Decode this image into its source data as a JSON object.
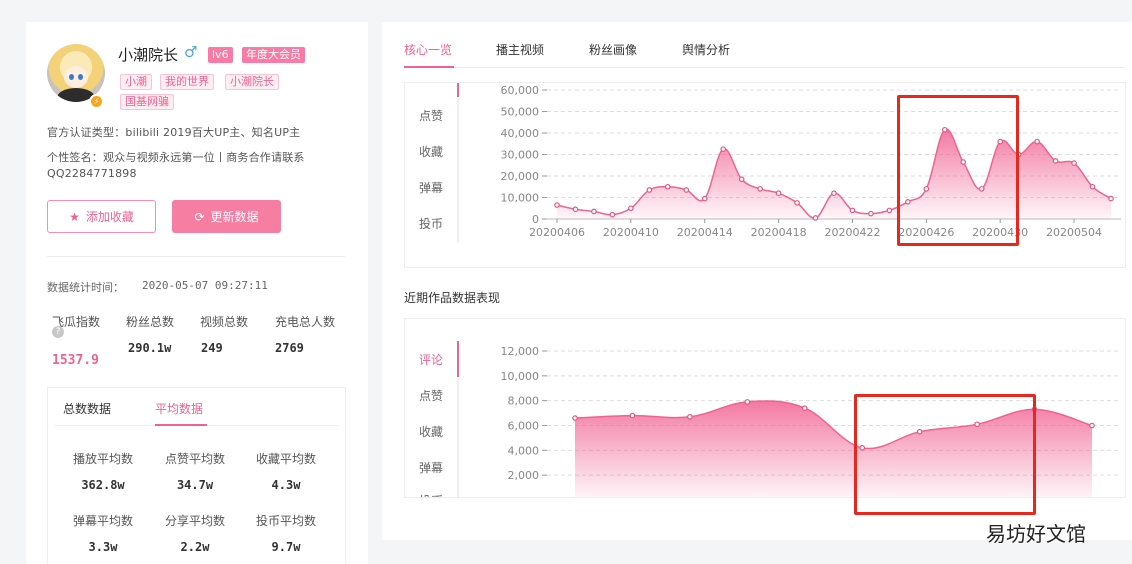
{
  "profile": {
    "name": "小潮院长",
    "gender_icon": "♂",
    "level": "lv6",
    "vip": "年度大会员",
    "tags": [
      "小潮",
      "我的世界",
      "小潮院长",
      "国基网骗"
    ],
    "cert": "官方认证类型：bilibili 2019百大UP主、知名UP主",
    "sign_line1": "个性签名：观众与视频永远第一位丨商务合作请联系",
    "sign_line2": "QQ2284771898"
  },
  "buttons": {
    "favorite": "添加收藏",
    "refresh": "更新数据"
  },
  "stats": {
    "time_label": "数据统计时间：",
    "time": "2020-05-07 09:27:11",
    "items": [
      {
        "label": "飞瓜指数",
        "value": "1537.9"
      },
      {
        "label": "粉丝总数",
        "value": "290.1w"
      },
      {
        "label": "视频总数",
        "value": "249"
      },
      {
        "label": "充电总人数",
        "value": "2769"
      }
    ]
  },
  "subtabs": [
    "总数数据",
    "平均数据"
  ],
  "averages": [
    {
      "label": "播放平均数",
      "value": "362.8w"
    },
    {
      "label": "点赞平均数",
      "value": "34.7w"
    },
    {
      "label": "收藏平均数",
      "value": "4.3w"
    },
    {
      "label": "弹幕平均数",
      "value": "3.3w"
    },
    {
      "label": "分享平均数",
      "value": "2.2w"
    },
    {
      "label": "投币平均数",
      "value": "9.7w"
    }
  ],
  "tabs": [
    "核心一览",
    "播主视频",
    "粉丝画像",
    "舆情分析"
  ],
  "section_title": "近期作品数据表现",
  "chart1_side": [
    "点赞",
    "收藏",
    "弹幕",
    "投币"
  ],
  "chart2_side": [
    "评论",
    "点赞",
    "收藏",
    "弹幕",
    "投币"
  ],
  "watermark": "易坊好文馆",
  "colors": {
    "accent": "#f06292",
    "highlight": "#e8271e"
  },
  "chart_data": [
    {
      "type": "area",
      "y_ticks": [
        "0",
        "10,000",
        "20,000",
        "30,000",
        "40,000",
        "50,000",
        "60,000"
      ],
      "ylim": [
        0,
        60000
      ],
      "x_ticks": [
        "20200406",
        "20200410",
        "20200414",
        "20200418",
        "20200422",
        "20200426",
        "20200430",
        "20200504"
      ],
      "x": [
        "20200406",
        "20200407",
        "20200408",
        "20200409",
        "20200410",
        "20200411",
        "20200412",
        "20200413",
        "20200414",
        "20200415",
        "20200416",
        "20200417",
        "20200418",
        "20200419",
        "20200420",
        "20200421",
        "20200422",
        "20200423",
        "20200424",
        "20200425",
        "20200426",
        "20200427",
        "20200428",
        "20200429",
        "20200430",
        "20200501",
        "20200502",
        "20200503",
        "20200504",
        "20200505",
        "20200506"
      ],
      "values": [
        6500,
        4500,
        3500,
        2000,
        5000,
        13500,
        15000,
        13500,
        9500,
        32500,
        18500,
        14000,
        12000,
        7500,
        500,
        12000,
        4000,
        2500,
        4000,
        8000,
        14000,
        41500,
        26500,
        14000,
        36000,
        30000,
        36000,
        27000,
        26000,
        15000,
        9500
      ]
    },
    {
      "type": "area",
      "y_ticks": [
        "2,000",
        "4,000",
        "6,000",
        "8,000",
        "10,000",
        "12,000"
      ],
      "ylim": [
        0,
        12000
      ],
      "values": [
        6600,
        6800,
        6700,
        7900,
        7400,
        4200,
        5500,
        6100,
        7300,
        6000
      ]
    }
  ]
}
